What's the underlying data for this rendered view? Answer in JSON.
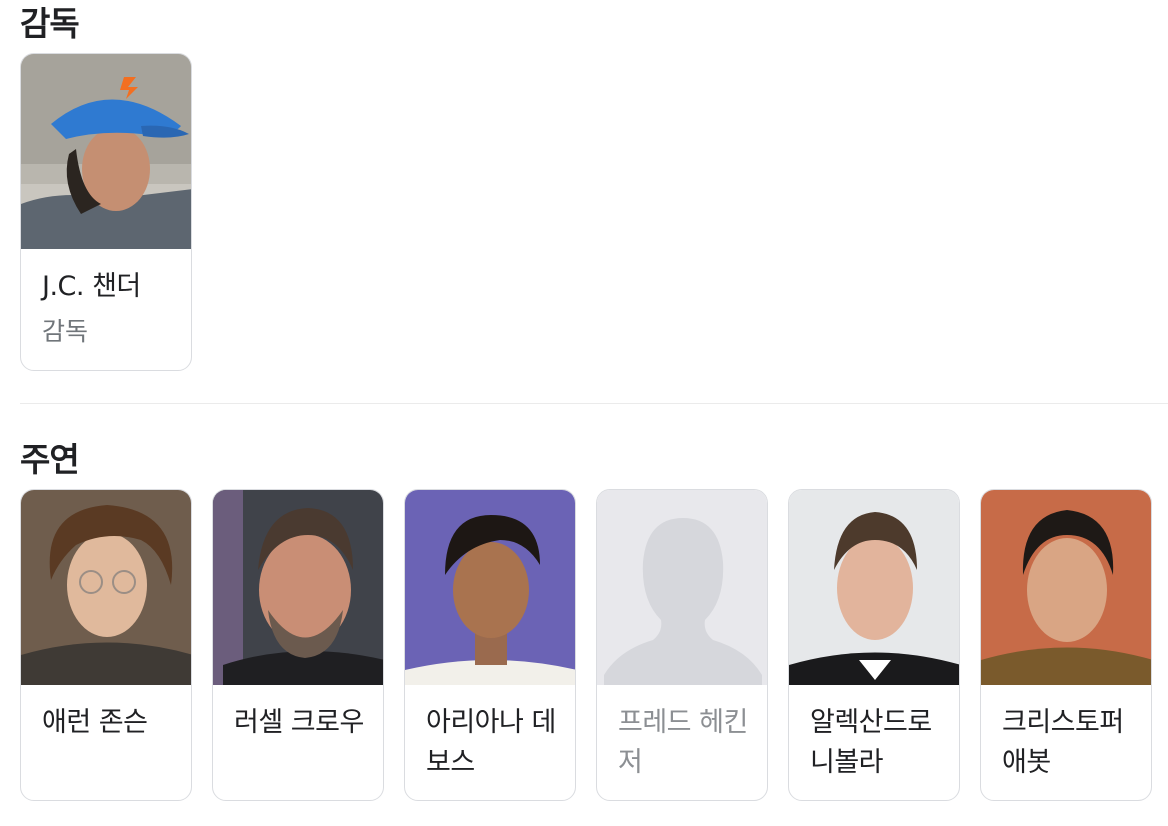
{
  "director_section": {
    "title": "감독",
    "person": {
      "name": "J.C. 챈더",
      "role": "감독"
    }
  },
  "cast_section": {
    "title": "주연",
    "people": [
      {
        "name": "애런 존슨",
        "has_photo": true
      },
      {
        "name": "러셀 크로우",
        "has_photo": true
      },
      {
        "name": "아리아나 데보스",
        "has_photo": true
      },
      {
        "name": "프레드 헤킨저",
        "has_photo": false
      },
      {
        "name": "알렉산드로 니볼라",
        "has_photo": true
      },
      {
        "name": "크리스토퍼 애봇",
        "has_photo": true
      }
    ]
  },
  "colors": {
    "card_border": "#dadce0",
    "secondary_text": "#70757a",
    "placeholder_bg": "#e8e8ec",
    "placeholder_figure": "#d6d7dc"
  }
}
